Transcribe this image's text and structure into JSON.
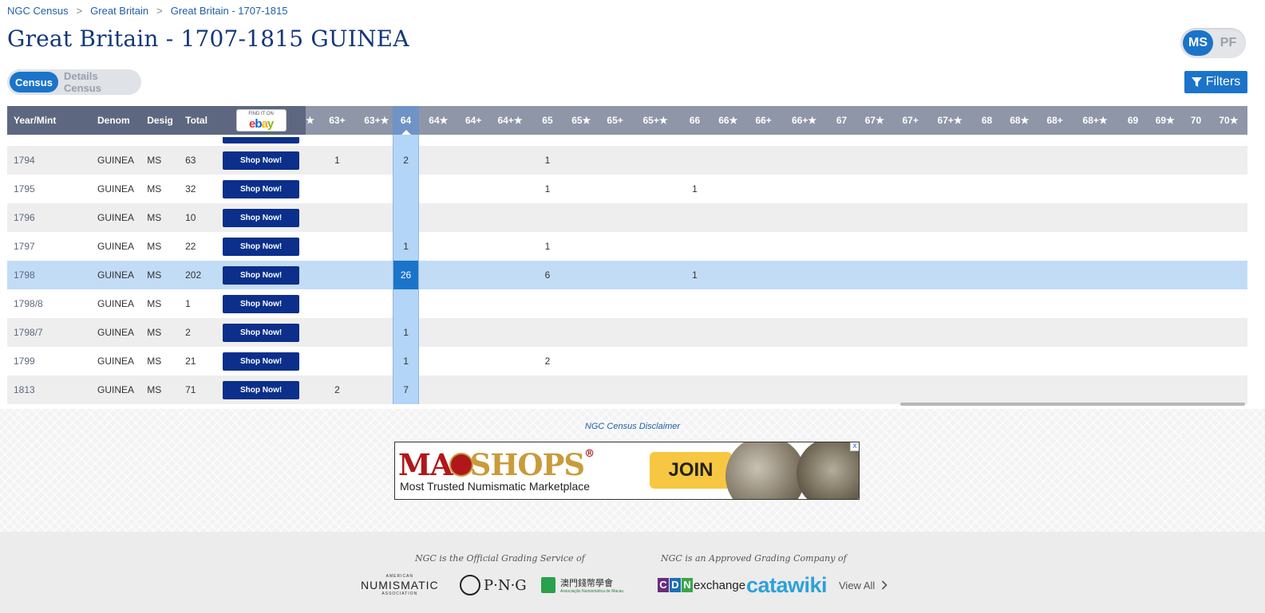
{
  "breadcrumb": {
    "items": [
      "NGC Census",
      "Great Britain",
      "Great Britain - 1707-1815"
    ],
    "separator": ">"
  },
  "page_title": "Great Britain - 1707-1815 GUINEA",
  "grade_type_toggle": {
    "options": [
      "MS",
      "PF"
    ],
    "selected": "MS"
  },
  "census_tabs": {
    "items": [
      "Census",
      "Details Census"
    ],
    "selected": "Census"
  },
  "filters_button": {
    "label": "Filters",
    "icon": "filter-icon"
  },
  "table": {
    "fixed_headers": [
      "Year/Mint",
      "Denom",
      "Desig",
      "Total"
    ],
    "ebay_header": {
      "small": "FIND IT ON",
      "word": "ebay"
    },
    "partial_header": "★",
    "grade_headers": [
      "63+",
      "63+★",
      "64",
      "64★",
      "64+",
      "64+★",
      "65",
      "65★",
      "65+",
      "65+★",
      "66",
      "66★",
      "66+",
      "66+★",
      "67",
      "67★",
      "67+",
      "67+★",
      "68",
      "68★",
      "68+",
      "68+★",
      "69",
      "69★",
      "70",
      "70★"
    ],
    "selected_grade": "64",
    "shop_label": "Shop Now!",
    "rows": [
      {
        "year": "1794",
        "denom": "GUINEA",
        "desig": "MS",
        "total": "63",
        "grades": {
          "63+": "1",
          "64": "2",
          "65": "1"
        }
      },
      {
        "year": "1795",
        "denom": "GUINEA",
        "desig": "MS",
        "total": "32",
        "grades": {
          "65": "1",
          "66": "1"
        }
      },
      {
        "year": "1796",
        "denom": "GUINEA",
        "desig": "MS",
        "total": "10",
        "grades": {}
      },
      {
        "year": "1797",
        "denom": "GUINEA",
        "desig": "MS",
        "total": "22",
        "grades": {
          "64": "1",
          "65": "1"
        }
      },
      {
        "year": "1798",
        "denom": "GUINEA",
        "desig": "MS",
        "total": "202",
        "grades": {
          "64": "26",
          "65": "6",
          "66": "1"
        },
        "highlighted": true
      },
      {
        "year": "1798/8",
        "denom": "GUINEA",
        "desig": "MS",
        "total": "1",
        "grades": {}
      },
      {
        "year": "1798/7",
        "denom": "GUINEA",
        "desig": "MS",
        "total": "2",
        "grades": {
          "64": "1"
        }
      },
      {
        "year": "1799",
        "denom": "GUINEA",
        "desig": "MS",
        "total": "21",
        "grades": {
          "64": "1",
          "65": "2"
        }
      },
      {
        "year": "1813",
        "denom": "GUINEA",
        "desig": "MS",
        "total": "71",
        "grades": {
          "63+": "2",
          "64": "7"
        }
      }
    ]
  },
  "disclaimer": "NGC Census Disclaimer",
  "ad": {
    "brand_left": "MA",
    "brand_right": "SHOPS",
    "registered": "®",
    "tagline": "Most Trusted Numismatic Marketplace",
    "join_label": "JOIN",
    "close_label": "x"
  },
  "footer": {
    "official_caption": "NGC is the Official Grading Service of",
    "approved_caption": "NGC is an Approved Grading Company of",
    "ana_small": "AMERICAN",
    "ana_big": "NUMISMATIC",
    "ana_sub": "ASSOCIATION",
    "png_label": "P·N·G",
    "amm_label": "澳門錢幣學會",
    "amm_sub": "Associação Numismática de Macau",
    "cdn_letters": [
      "C",
      "D",
      "N"
    ],
    "cdn_word": "exchange",
    "catawiki": "catawiki",
    "view_all": "View All"
  },
  "colors": {
    "accent": "#1b74c9",
    "title": "#13377a",
    "header_dark": "#5d6880",
    "header_light": "#8e96a8",
    "shop_button": "#0b2f8a",
    "row_highlight": "#c3dcf6",
    "column_highlight": "#b3d5f8"
  }
}
